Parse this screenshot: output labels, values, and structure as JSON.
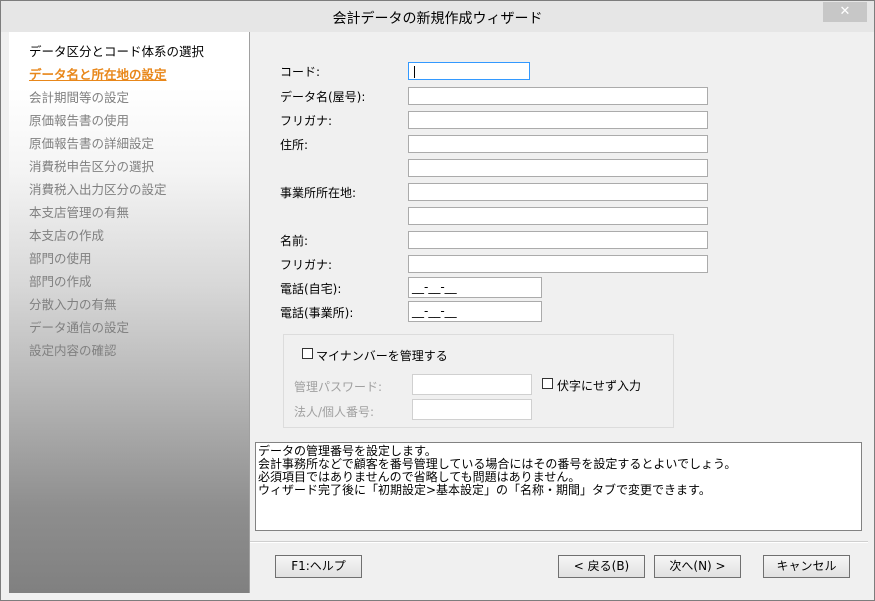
{
  "window": {
    "title": "会計データの新規作成ウィザード",
    "close_glyph": "✕"
  },
  "sidebar": {
    "steps": [
      {
        "label": "データ区分とコード体系の選択",
        "state": "done"
      },
      {
        "label": "データ名と所在地の設定",
        "state": "current"
      },
      {
        "label": "会計期間等の設定",
        "state": "pending"
      },
      {
        "label": "原価報告書の使用",
        "state": "pending"
      },
      {
        "label": "原価報告書の詳細設定",
        "state": "pending"
      },
      {
        "label": "消費税申告区分の選択",
        "state": "pending"
      },
      {
        "label": "消費税入出力区分の設定",
        "state": "pending"
      },
      {
        "label": "本支店管理の有無",
        "state": "pending"
      },
      {
        "label": "本支店の作成",
        "state": "pending"
      },
      {
        "label": "部門の使用",
        "state": "pending"
      },
      {
        "label": "部門の作成",
        "state": "pending"
      },
      {
        "label": "分散入力の有無",
        "state": "pending"
      },
      {
        "label": "データ通信の設定",
        "state": "pending"
      },
      {
        "label": "設定内容の確認",
        "state": "pending"
      }
    ]
  },
  "form": {
    "code_label": "コード:",
    "code_value": "",
    "name_label": "データ名(屋号):",
    "name_value": "",
    "name_kana_label": "フリガナ:",
    "name_kana_value": "",
    "address_label": "住所:",
    "address_line1": "",
    "address_line2": "",
    "office_label": "事業所所在地:",
    "office_line1": "",
    "office_line2": "",
    "person_label": "名前:",
    "person_value": "",
    "person_kana_label": "フリガナ:",
    "person_kana_value": "",
    "tel_home_label": "電話(自宅):",
    "tel_home_value": "__-__-__",
    "tel_office_label": "電話(事業所):",
    "tel_office_value": "__-__-__"
  },
  "mynumber": {
    "manage_label": "マイナンバーを管理する",
    "manage_checked": false,
    "password_label": "管理パスワード:",
    "password_value": "",
    "no_mask_label": "伏字にせず入力",
    "no_mask_checked": false,
    "number_label": "法人/個人番号:",
    "number_value": ""
  },
  "info": {
    "lines": [
      "データの管理番号を設定します。",
      "会計事務所などで顧客を番号管理している場合にはその番号を設定するとよいでしょう。",
      "必須項目ではありませんので省略しても問題はありません。",
      "ウィザード完了後に「初期設定>基本設定」の「名称・期間」タブで変更できます。"
    ]
  },
  "buttons": {
    "help": "F1:ヘルプ",
    "back": "< 戻る(B)",
    "next": "次へ(N) >",
    "cancel": "キャンセル"
  },
  "colors": {
    "current_step": "#e8871a",
    "disabled_text": "#808080",
    "focus_border": "#3399ff"
  }
}
